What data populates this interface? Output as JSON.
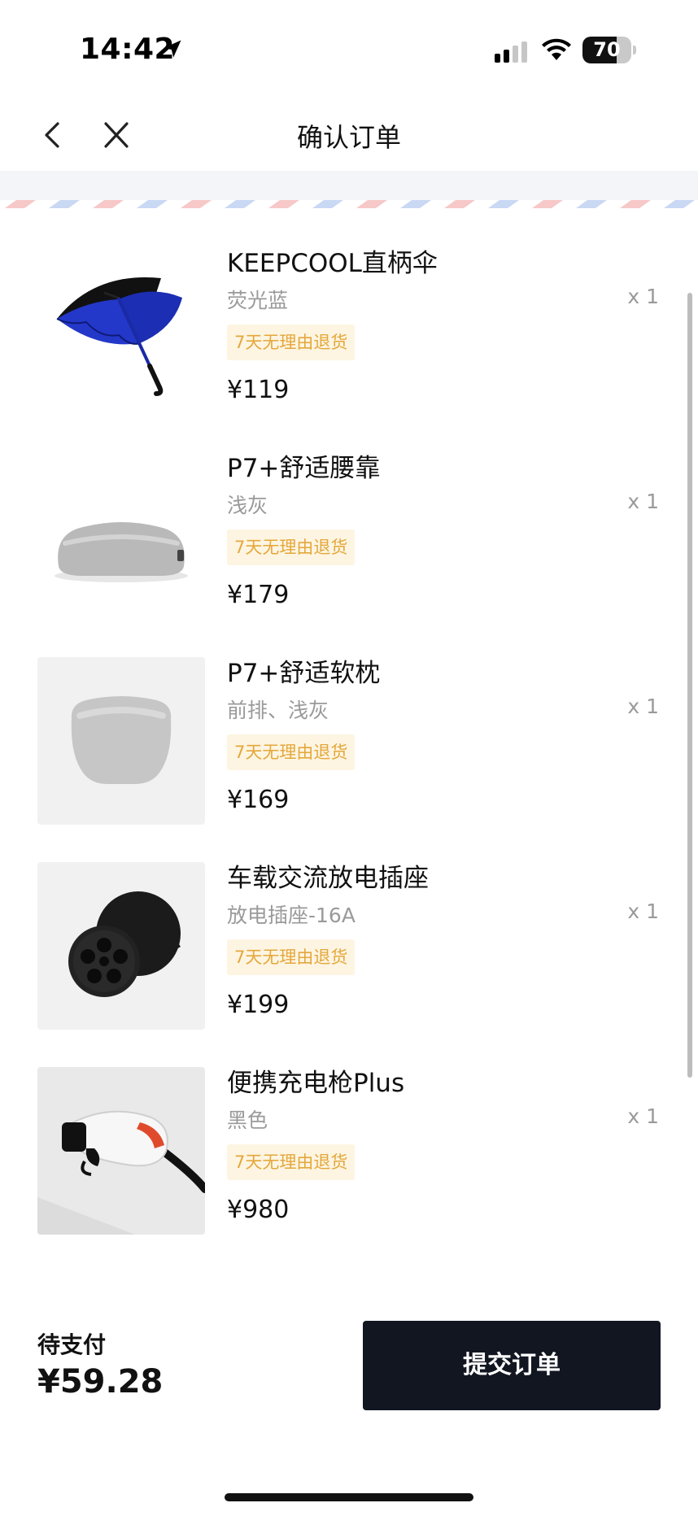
{
  "status_bar": {
    "time": "14:42",
    "battery": "70",
    "battery_level": 0.7
  },
  "nav": {
    "title": "确认订单"
  },
  "items": [
    {
      "name": "KEEPCOOL直柄伞",
      "spec": "荧光蓝",
      "qty": "x 1",
      "badge": "7天无理由退货",
      "price": "¥119",
      "image": "umbrella"
    },
    {
      "name": "P7+舒适腰靠",
      "spec": "浅灰",
      "qty": "x 1",
      "badge": "7天无理由退货",
      "price": "¥179",
      "image": "lumbar-cushion"
    },
    {
      "name": "P7+舒适软枕",
      "spec": "前排、浅灰",
      "qty": "x 1",
      "badge": "7天无理由退货",
      "price": "¥169",
      "image": "headrest-pillow"
    },
    {
      "name": "车载交流放电插座",
      "spec": "放电插座-16A",
      "qty": "x 1",
      "badge": "7天无理由退货",
      "price": "¥199",
      "image": "discharge-socket"
    },
    {
      "name": "便携充电枪Plus",
      "spec": "黑色",
      "qty": "x 1",
      "badge": "7天无理由退货",
      "price": "¥980",
      "image": "charging-gun"
    }
  ],
  "footer": {
    "pay_label": "待支付",
    "pay_amount": "¥59.28",
    "submit_label": "提交订单"
  },
  "colors": {
    "badge_bg": "#fdf5e2",
    "badge_text": "#e5a73b",
    "submit_bg": "#111621"
  }
}
